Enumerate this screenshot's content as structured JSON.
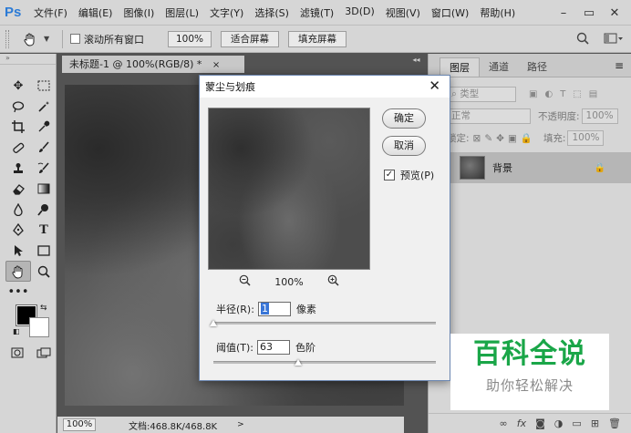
{
  "menubar": {
    "logo": "Ps",
    "items": [
      "文件(F)",
      "编辑(E)",
      "图像(I)",
      "图层(L)",
      "文字(Y)",
      "选择(S)",
      "滤镜(T)",
      "3D(D)",
      "视图(V)",
      "窗口(W)",
      "帮助(H)"
    ],
    "minimize": "–",
    "maximize": "▭",
    "close": "✕"
  },
  "optionsbar": {
    "scroll_all": "滚动所有窗口",
    "zoom": "100%",
    "fit_screen": "适合屏幕",
    "fill_screen": "填充屏幕"
  },
  "document": {
    "tab_title": "未标题-1 @ 100%(RGB/8) *",
    "tab_close": "×",
    "status_zoom": "100%",
    "status_doc": "文档:468.8K/468.8K",
    "status_arrow": ">"
  },
  "layers_panel": {
    "tabs": [
      "图层",
      "通道",
      "路径"
    ],
    "filter_kind": "类型",
    "blend_mode": "正常",
    "opacity_label": "不透明度:",
    "opacity_value": "100%",
    "lock_label": "锁定:",
    "fill_label": "填充:",
    "fill_value": "100%",
    "layer_name": "背景"
  },
  "dialog": {
    "title": "蒙尘与划痕",
    "close": "✕",
    "ok": "确定",
    "cancel": "取消",
    "preview_label": "预览(P)",
    "preview_checked": true,
    "zoom_value": "100%",
    "radius_label": "半径(R):",
    "radius_value": "1",
    "radius_unit": "像素",
    "radius_slider": 0.0,
    "threshold_label": "阈值(T):",
    "threshold_value": "63",
    "threshold_unit": "色阶",
    "threshold_slider": 0.38
  },
  "watermark": {
    "main": "百科全说",
    "sub": "助你轻松解决"
  }
}
